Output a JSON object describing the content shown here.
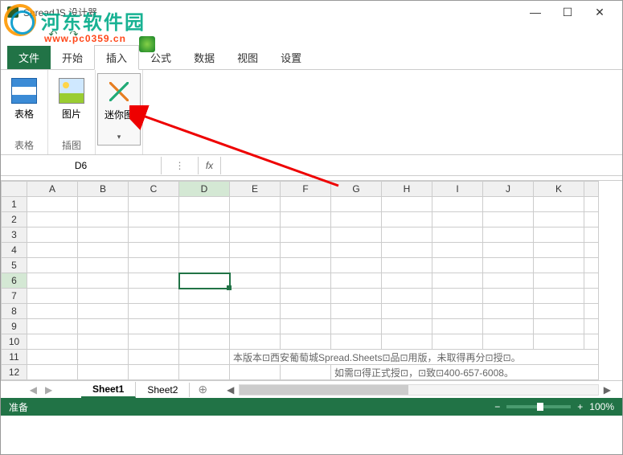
{
  "app": {
    "title": "SpreadJS 设计器"
  },
  "window_controls": {
    "min": "—",
    "max": "☐",
    "close": "✕"
  },
  "watermark": {
    "text": "河东软件园",
    "url": "www.pc0359.cn"
  },
  "tabs": {
    "file": "文件",
    "items": [
      "开始",
      "插入",
      "公式",
      "数据",
      "视图",
      "设置"
    ],
    "active": "插入"
  },
  "ribbon": {
    "groups": [
      {
        "label": "表格",
        "buttons": [
          {
            "name": "table",
            "label": "表格"
          }
        ]
      },
      {
        "label": "插图",
        "buttons": [
          {
            "name": "pic",
            "label": "图片"
          }
        ]
      },
      {
        "label": "",
        "buttons": [
          {
            "name": "spark",
            "label": "迷你图",
            "dropdown": true,
            "active": true
          }
        ]
      }
    ]
  },
  "formula_bar": {
    "cell_ref": "D6",
    "menu": "⋮",
    "fx": "fx",
    "value": ""
  },
  "grid": {
    "columns": [
      "A",
      "B",
      "C",
      "D",
      "E",
      "F",
      "G",
      "H",
      "I",
      "J",
      "K"
    ],
    "rows": [
      1,
      2,
      3,
      4,
      5,
      6,
      7,
      8,
      9,
      10,
      11,
      12
    ],
    "active_col": "D",
    "active_row": 6,
    "messages": {
      "11": "本版本⊡西安葡萄城Spread.Sheets⊡品⊡用版，未取得再分⊡授⊡。",
      "12": "如需⊡得正式授⊡，⊡致⊡400-657-6008。"
    }
  },
  "sheet_tabs": {
    "nav_prev": "◀",
    "nav_next": "▶",
    "sheets": [
      "Sheet1",
      "Sheet2"
    ],
    "active": "Sheet1",
    "add": "⊕"
  },
  "statusbar": {
    "status": "准备",
    "zoom_out": "−",
    "zoom_in": "+",
    "zoom": "100%"
  },
  "chart_data": null
}
